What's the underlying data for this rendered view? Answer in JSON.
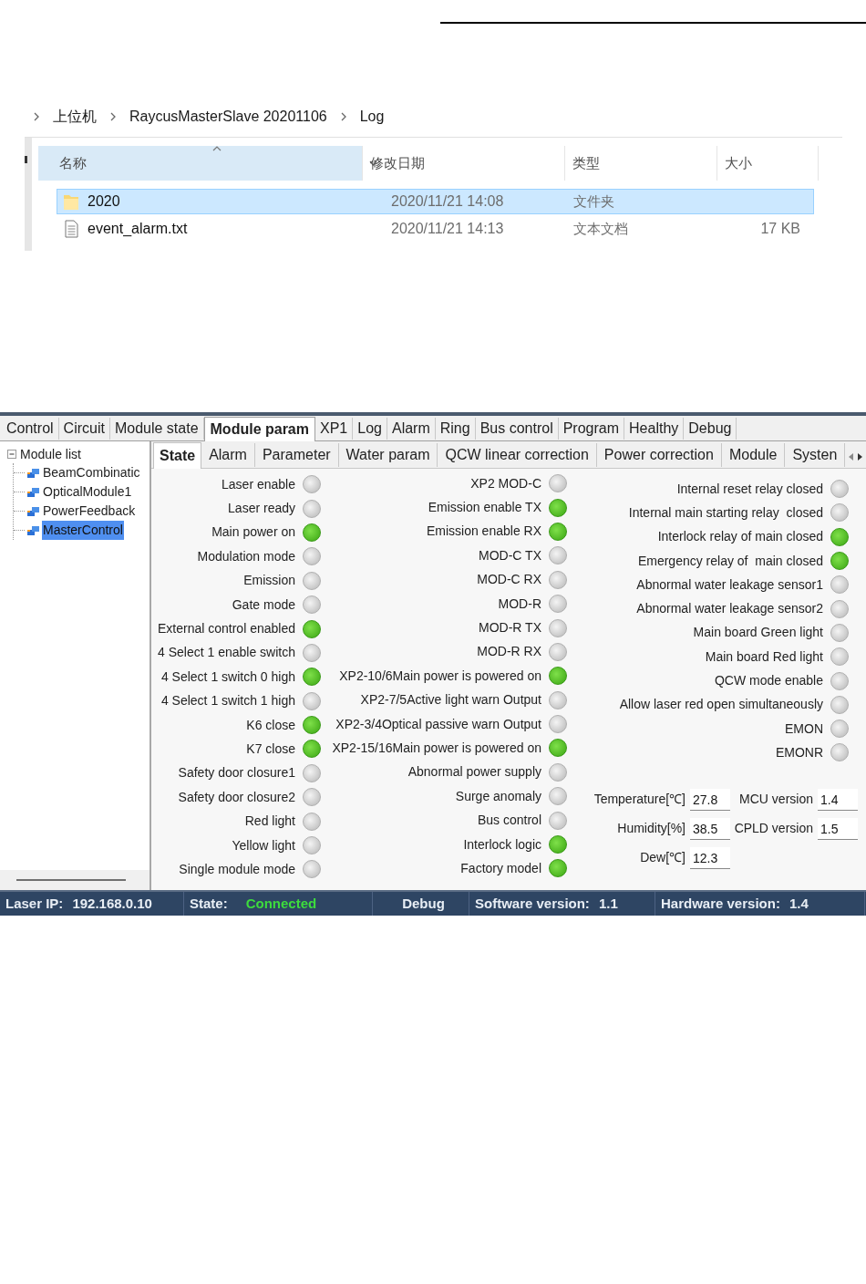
{
  "explorer": {
    "breadcrumb": [
      "上位机",
      "RaycusMasterSlave 20201106",
      "Log"
    ],
    "columns": [
      {
        "label": "名称",
        "sorted": true
      },
      {
        "label": "修改日期",
        "sorted": false
      },
      {
        "label": "类型",
        "sorted": false
      },
      {
        "label": "大小",
        "sorted": false
      }
    ],
    "rows": [
      {
        "kind": "folder",
        "name": "2020",
        "modified": "2020/11/21 14:08",
        "type": "文件夹",
        "size": "",
        "selected": true
      },
      {
        "kind": "file",
        "name": "event_alarm.txt",
        "modified": "2020/11/21 14:13",
        "type": "文本文档",
        "size": "17 KB",
        "selected": false
      }
    ]
  },
  "app": {
    "tabs": [
      {
        "label": "Control",
        "selected": false
      },
      {
        "label": "Circuit",
        "selected": false
      },
      {
        "label": "Module state",
        "selected": false
      },
      {
        "label": "Module param",
        "selected": true
      },
      {
        "label": "XP1",
        "selected": false
      },
      {
        "label": "Log",
        "selected": false
      },
      {
        "label": "Alarm",
        "selected": false
      },
      {
        "label": "Ring",
        "selected": false
      },
      {
        "label": "Bus control",
        "selected": false
      },
      {
        "label": "Program",
        "selected": false
      },
      {
        "label": "Healthy",
        "selected": false
      },
      {
        "label": "Debug",
        "selected": false
      }
    ],
    "tree": {
      "label": "Module list",
      "expanded": true,
      "children": [
        {
          "label": "BeamCombinatic",
          "selected": false
        },
        {
          "label": "OpticalModule1",
          "selected": false
        },
        {
          "label": "PowerFeedback",
          "selected": false
        },
        {
          "label": "MasterControl",
          "selected": true
        }
      ]
    },
    "subtabs": [
      {
        "label": "State",
        "selected": true
      },
      {
        "label": "Alarm",
        "selected": false
      },
      {
        "label": "Parameter",
        "selected": false
      },
      {
        "label": "Water param",
        "selected": false
      },
      {
        "label": "QCW linear correction",
        "selected": false
      },
      {
        "label": "Power correction",
        "selected": false
      },
      {
        "label": "Module",
        "selected": false
      },
      {
        "label": "Systen",
        "selected": false
      }
    ],
    "indicators": [
      [
        {
          "label": "Laser enable",
          "on": false
        },
        {
          "label": "Laser ready",
          "on": false
        },
        {
          "label": "Main power on",
          "on": true
        },
        {
          "label": "Modulation mode",
          "on": false
        },
        {
          "label": "Emission",
          "on": false
        },
        {
          "label": "Gate mode",
          "on": false
        },
        {
          "label": "External control enabled",
          "on": true
        },
        {
          "label": "4 Select 1 enable switch",
          "on": false
        },
        {
          "label": "4 Select 1 switch 0 high",
          "on": true
        },
        {
          "label": "4 Select 1 switch 1 high",
          "on": false
        },
        {
          "label": "K6 close",
          "on": true
        },
        {
          "label": "K7 close",
          "on": true
        },
        {
          "label": "Safety door closure1",
          "on": false
        },
        {
          "label": "Safety door closure2",
          "on": false
        },
        {
          "label": "Red light",
          "on": false
        },
        {
          "label": "Yellow light",
          "on": false
        },
        {
          "label": "Single module mode",
          "on": false
        }
      ],
      [
        {
          "label": "XP2 MOD-C",
          "on": false
        },
        {
          "label": "Emission enable TX",
          "on": true
        },
        {
          "label": "Emission enable RX",
          "on": true
        },
        {
          "label": "MOD-C TX",
          "on": false
        },
        {
          "label": "MOD-C RX",
          "on": false
        },
        {
          "label": "MOD-R",
          "on": false
        },
        {
          "label": "MOD-R TX",
          "on": false
        },
        {
          "label": "MOD-R RX",
          "on": false
        },
        {
          "label": "XP2-10/6Main power is powered on",
          "on": true
        },
        {
          "label": "XP2-7/5Active light warn Output",
          "on": false
        },
        {
          "label": "XP2-3/4Optical passive warn Output",
          "on": false
        },
        {
          "label": "XP2-15/16Main power is powered on",
          "on": true
        },
        {
          "label": "Abnormal power supply",
          "on": false
        },
        {
          "label": "Surge anomaly",
          "on": false
        },
        {
          "label": "Bus control",
          "on": false
        },
        {
          "label": "Interlock logic",
          "on": true
        },
        {
          "label": "Factory model",
          "on": true
        }
      ],
      [
        {
          "label": "Internal reset relay closed",
          "on": false
        },
        {
          "label": "Internal main starting relay  closed",
          "on": false
        },
        {
          "label": "Interlock relay of main closed",
          "on": true
        },
        {
          "label": "Emergency relay of  main closed",
          "on": true
        },
        {
          "label": "Abnormal water leakage sensor1",
          "on": false
        },
        {
          "label": "Abnormal water leakage sensor2",
          "on": false
        },
        {
          "label": "Main board Green light",
          "on": false
        },
        {
          "label": "Main board Red light",
          "on": false
        },
        {
          "label": "QCW mode enable",
          "on": false
        },
        {
          "label": "Allow laser red open simultaneously",
          "on": false
        },
        {
          "label": "EMON",
          "on": false
        },
        {
          "label": "EMONR",
          "on": false
        }
      ]
    ],
    "readings": [
      [
        {
          "label": "Temperature[℃]",
          "value": "27.8"
        },
        {
          "label": "MCU version",
          "value": "1.4"
        }
      ],
      [
        {
          "label": "Humidity[%]",
          "value": "38.5"
        },
        {
          "label": "CPLD version",
          "value": "1.5"
        }
      ],
      [
        {
          "label": "Dew[℃]",
          "value": "12.3"
        }
      ]
    ],
    "status_bar": [
      {
        "kind": "plain",
        "label": "Laser IP:",
        "value": "192.168.0.10"
      },
      {
        "kind": "status",
        "label": "State:",
        "value": "Connected"
      },
      {
        "kind": "mode",
        "label": "Debug"
      },
      {
        "kind": "plain",
        "label": "Software version:",
        "value": "1.1"
      },
      {
        "kind": "plain",
        "label": "Hardware version:",
        "value": "1.4"
      }
    ]
  }
}
